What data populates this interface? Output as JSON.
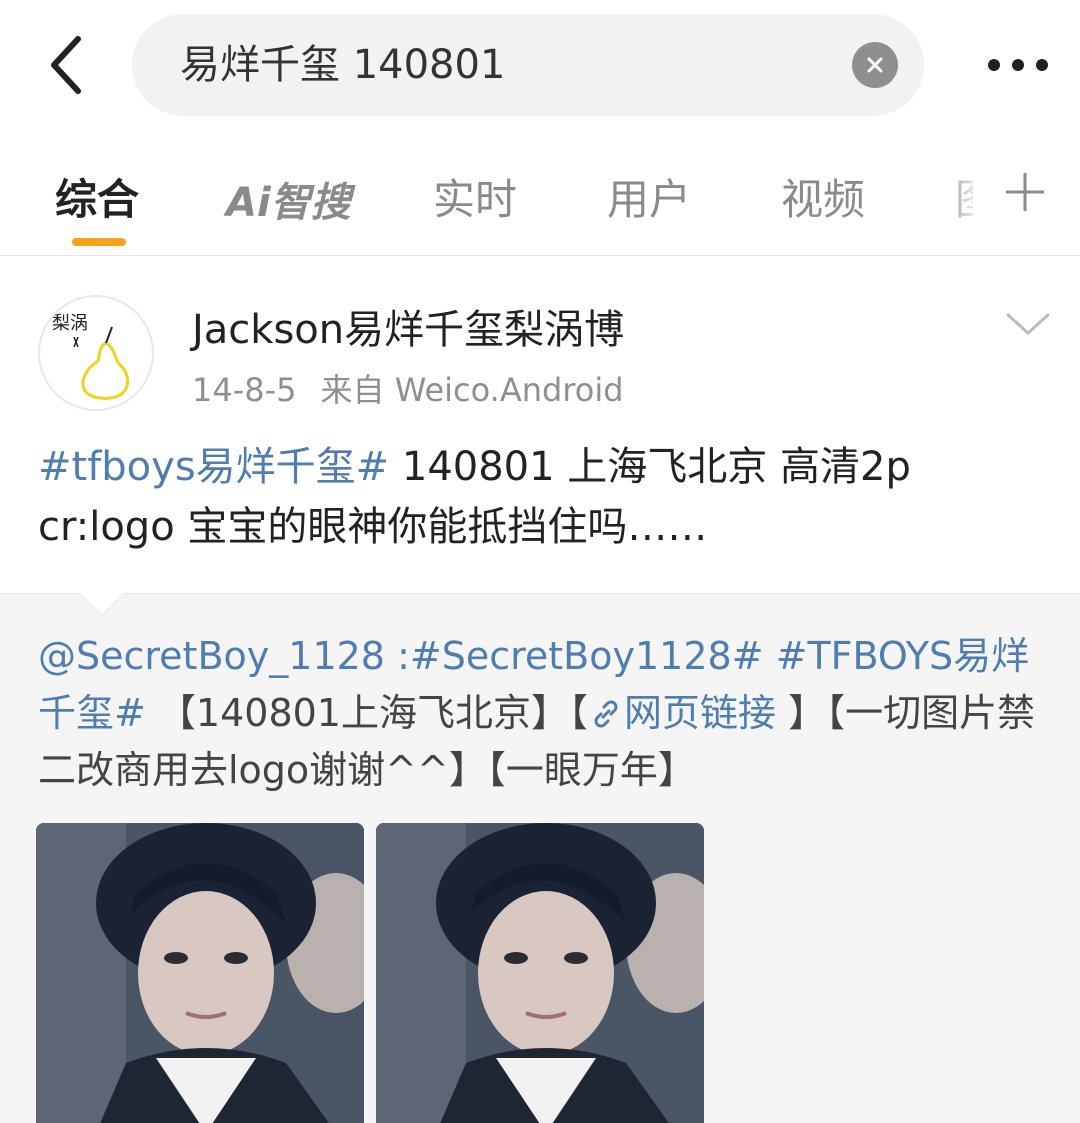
{
  "search": {
    "query": "易烊千玺 140801"
  },
  "tabs": [
    {
      "label": "综合",
      "active": true
    },
    {
      "label": "Ai智搜",
      "active": false
    },
    {
      "label": "实时",
      "active": false
    },
    {
      "label": "用户",
      "active": false
    },
    {
      "label": "视频",
      "active": false
    },
    {
      "label": "图",
      "active": false
    }
  ],
  "post": {
    "username": "Jackson易烊千玺梨涡博",
    "time": "14-8-5",
    "source": "来自 Weico.Android",
    "topic": "#tfboys易烊千玺#",
    "text_after_topic": " 140801  上海飞北京 高清2p cr:logo   宝宝的眼神你能抵挡住吗……",
    "avatar_text": "梨涡"
  },
  "retweet": {
    "mention": "@SecretBoy_1128",
    "colon": " :",
    "topic1": "#SecretBoy1128#",
    "space": " ",
    "topic2": "#TFBOYS易烊千玺#",
    "text1": " 【140801上海飞北京】【",
    "link_label": "网页链接",
    "text2": " 】【一切图片禁二改商用去logo谢谢^^】【一眼万年】"
  },
  "colors": {
    "accent_underline": "#f7a21b",
    "link_blue": "#507daf",
    "search_bg": "#f2f2f2",
    "retweet_bg": "#f5f5f5"
  },
  "icons": [
    "back-arrow-icon",
    "clear-icon",
    "more-dots-icon",
    "plus-icon",
    "chevron-down-icon",
    "link-icon"
  ]
}
